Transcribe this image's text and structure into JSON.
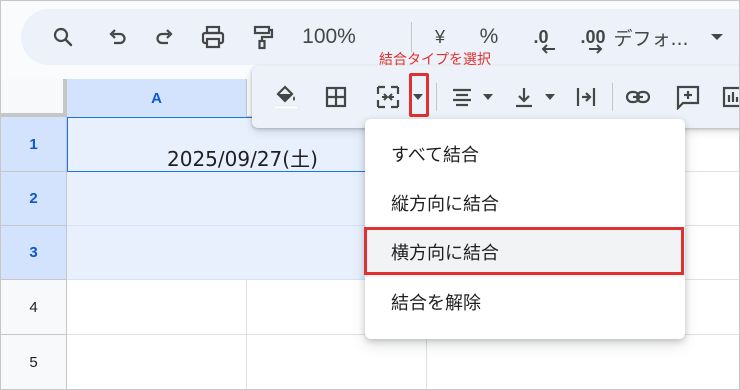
{
  "toolbar": {
    "zoom": "100%",
    "currency_symbol": "¥",
    "percent_symbol": "%",
    "decrease_decimal": ".0",
    "increase_decimal": ".00",
    "format_label": "デフォ..."
  },
  "sheet": {
    "columns": [
      "A"
    ],
    "rows": [
      "1",
      "2",
      "3",
      "4",
      "5"
    ],
    "merged_cell_value": "2025/09/27(土)"
  },
  "annotation": {
    "label": "結合タイプを選択"
  },
  "merge_menu": {
    "items": [
      "すべて結合",
      "縦方向に結合",
      "横方向に結合",
      "結合を解除"
    ],
    "highlighted_index": 2
  },
  "colors": {
    "accent": "#1a73e8",
    "annotation": "#e0302f",
    "selection": "#e8f0fe",
    "header_selected": "#d3e3fd"
  },
  "icons": [
    "search-icon",
    "undo-icon",
    "redo-icon",
    "print-icon",
    "paint-format-icon",
    "fill-color-icon",
    "borders-icon",
    "merge-cells-icon",
    "horizontal-align-icon",
    "vertical-align-icon",
    "text-wrap-icon",
    "link-icon",
    "comment-icon",
    "chart-icon"
  ]
}
